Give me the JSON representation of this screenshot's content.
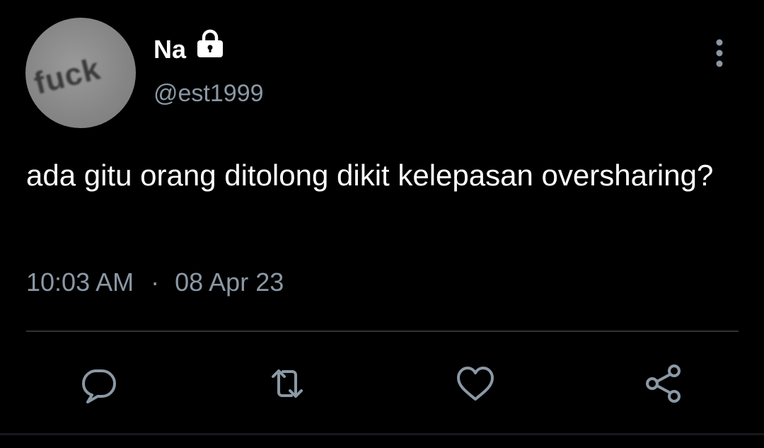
{
  "author": {
    "display_name": "Na",
    "handle": "@est1999",
    "avatar_text": "fuck",
    "protected_icon": "lock-icon"
  },
  "tweet": {
    "text": "ada gitu orang ditolong dikit kelepasan oversharing?",
    "time": "10:03 AM",
    "separator": "·",
    "date": "08 Apr 23"
  },
  "actions": [
    {
      "name": "reply",
      "icon": "comment-icon"
    },
    {
      "name": "retweet",
      "icon": "retweet-icon"
    },
    {
      "name": "like",
      "icon": "heart-icon"
    },
    {
      "name": "share",
      "icon": "share-icon"
    }
  ],
  "colors": {
    "background": "#000000",
    "primary_text": "#ffffff",
    "secondary_text": "#8b98a5",
    "divider": "#2f3336"
  }
}
